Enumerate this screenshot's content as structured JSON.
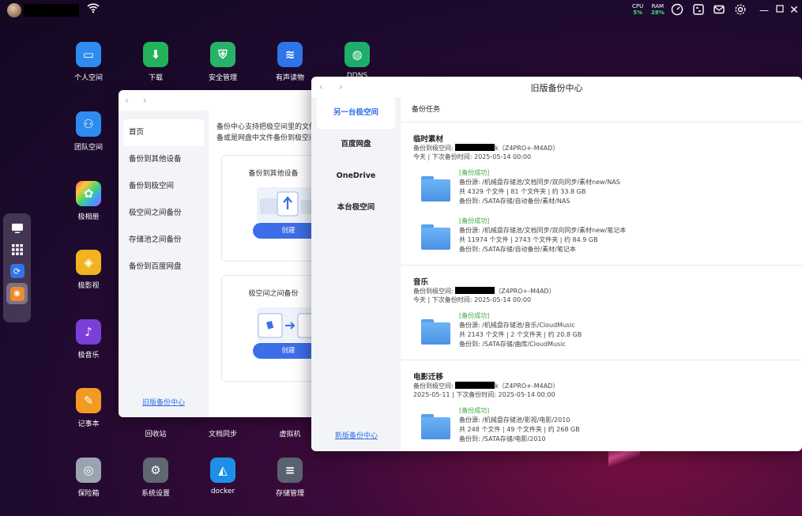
{
  "topbar": {
    "cpu_label": "CPU",
    "cpu_value": "5%",
    "ram_label": "RAM",
    "ram_value": "28%"
  },
  "desktop": {
    "apps": [
      {
        "label": "个人空间",
        "icon": "folder-icon",
        "color": "#2e8cf0"
      },
      {
        "label": "下载",
        "icon": "download-icon",
        "color": "#22b35a"
      },
      {
        "label": "安全管理",
        "icon": "shield-icon",
        "color": "#27b36a"
      },
      {
        "label": "有声读物",
        "icon": "audio-wave-icon",
        "color": "#2f74e8"
      },
      {
        "label": "DDNS",
        "icon": "ddns-globe-icon",
        "color": "#1fae6a"
      },
      {
        "label": "团队空间",
        "icon": "team-icon",
        "color": "#2e8cf0"
      },
      {
        "label": "极相册",
        "icon": "photos-icon",
        "color": "#ffffff"
      },
      {
        "label": "极影视",
        "icon": "video-icon",
        "color": "#f2b320"
      },
      {
        "label": "极音乐",
        "icon": "music-icon",
        "color": "#7a3fd8"
      },
      {
        "label": "记事本",
        "icon": "notepad-icon",
        "color": "#f29a22"
      },
      {
        "label": "回收站",
        "icon": "trash-icon",
        "color": "#666666"
      },
      {
        "label": "文档同步",
        "icon": "sync-icon",
        "color": "#666666"
      },
      {
        "label": "虚拟机",
        "icon": "vm-icon",
        "color": "#666666"
      },
      {
        "label": "保险箱",
        "icon": "safe-icon",
        "color": "#9aa4b0"
      },
      {
        "label": "系统设置",
        "icon": "gear-icon",
        "color": "#5f6773"
      },
      {
        "label": "docker",
        "icon": "docker-icon",
        "color": "#1d8fe8"
      },
      {
        "label": "存储管理",
        "icon": "storage-icon",
        "color": "#5a6270"
      }
    ]
  },
  "window_new": {
    "sidebar": [
      "首页",
      "备份到其他设备",
      "备份到极空间",
      "极空间之间备份",
      "存储池之间备份",
      "备份到百度网盘"
    ],
    "old_link": "旧版备份中心",
    "desc_line1": "备份中心支持把极空间里的文件",
    "desc_line2": "备或是网盘中文件备份到极空间",
    "card1_title": "备份到其他设备",
    "card2_title": "极空间之间备份",
    "create_label": "创建"
  },
  "window_old": {
    "title": "旧版备份中心",
    "sidebar": [
      "另一台极空间",
      "百度网盘",
      "OneDrive",
      "本台极空间"
    ],
    "new_link": "新版备份中心",
    "section_title": "备份任务",
    "tasks": [
      {
        "name": "临时素材",
        "target_prefix": "备份到极空间:",
        "target_suffix": "k（Z4PRO+-M4AD）",
        "schedule": "今天 | 下次备份时间: 2025-05-14 00:00",
        "records": [
          {
            "status": "[备份成功]",
            "source": "备份源: /机械盘存储池/文档同步/双向同步/素材new/NAS",
            "stats": "共 4329 个文件 | 81 个文件夹 | 约 33.8 GB",
            "dest": "备份到: /SATA存储/自动备份/素材/NAS"
          },
          {
            "status": "[备份成功]",
            "source": "备份源: /机械盘存储池/文档同步/双向同步/素材new/笔记本",
            "stats": "共 11974 个文件 | 2743 个文件夹 | 约 84.9 GB",
            "dest": "备份到: /SATA存储/自动备份/素材/笔记本"
          }
        ]
      },
      {
        "name": "音乐",
        "target_prefix": "备份到极空间:",
        "target_suffix": "（Z4PRO+-M4AD）",
        "schedule": "今天 | 下次备份时间: 2025-05-14 00:00",
        "records": [
          {
            "status": "[备份成功]",
            "source": "备份源: /机械盘存储池/音乐/CloudMusic",
            "stats": "共 2143 个文件 | 2 个文件夹 | 约 20.8 GB",
            "dest": "备份到: /SATA存储/曲库/CloudMusic"
          }
        ]
      },
      {
        "name": "电影迁移",
        "target_prefix": "备份到极空间:",
        "target_suffix": "k（Z4PRO+-M4AD）",
        "schedule": "2025-05-11 | 下次备份时间: 2025-05-14 00:00",
        "records": [
          {
            "status": "[备份成功]",
            "source": "备份源: /机械盘存储池/影视/电影/2010",
            "stats": "共 248 个文件 | 49 个文件夹 | 约 268 GB",
            "dest": "备份到: /SATA存储/电影/2010"
          }
        ]
      }
    ]
  }
}
